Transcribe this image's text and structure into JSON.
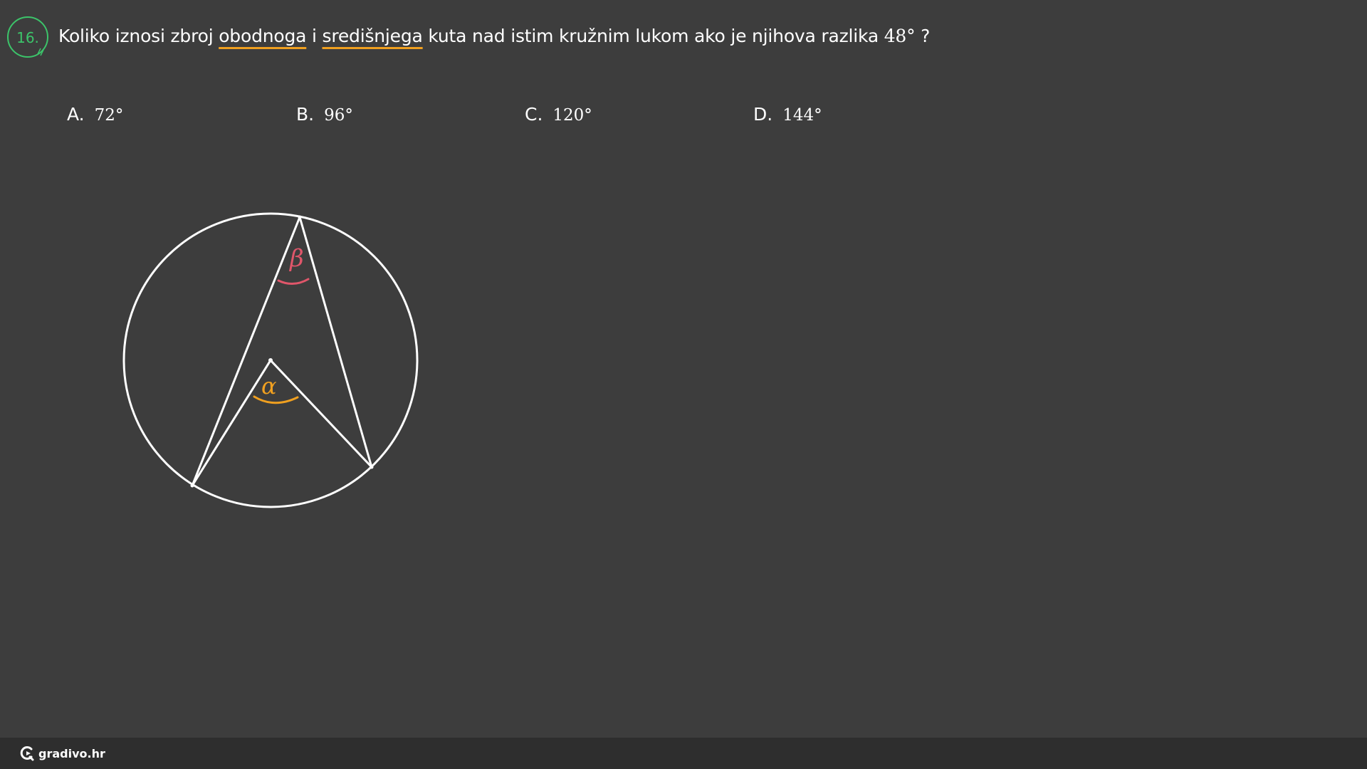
{
  "question": {
    "number": "16.",
    "part1": "Koliko iznosi zbroj ",
    "highlight1": "obodnoga",
    "part2": " i ",
    "highlight2": "središnjega",
    "part3": " kuta nad istim kružnim lukom ako je njihova razlika ",
    "value": "48°",
    "part4": " ?"
  },
  "options": [
    {
      "letter": "A.",
      "value": "72°"
    },
    {
      "letter": "B.",
      "value": "96°"
    },
    {
      "letter": "C.",
      "value": "120°"
    },
    {
      "letter": "D.",
      "value": "144°"
    }
  ],
  "figure": {
    "central_angle_label": "α",
    "inscribed_angle_label": "β",
    "colors": {
      "lines": "#ffffff",
      "central_angle": "#f0a020",
      "inscribed_angle": "#e0566a"
    }
  },
  "footer": {
    "brand": "gradivo.hr"
  },
  "colors": {
    "background": "#3d3d3d",
    "footer": "#2e2e2e",
    "badge": "#3cc46a",
    "underline": "#f0a020"
  }
}
